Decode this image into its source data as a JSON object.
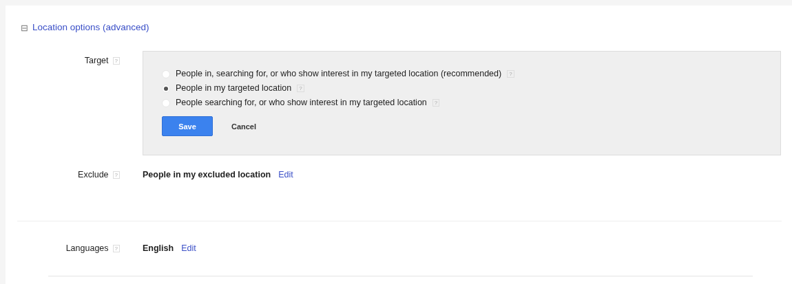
{
  "section": {
    "toggle": "⊟",
    "title": "Location options (advanced)"
  },
  "target": {
    "label": "Target",
    "help": "?",
    "options": [
      {
        "label": "People in, searching for, or who show interest in my targeted location (recommended)",
        "help": "?",
        "selected": false
      },
      {
        "label": "People in my targeted location",
        "help": "?",
        "selected": true
      },
      {
        "label": "People searching for, or who show interest in my targeted location",
        "help": "?",
        "selected": false
      }
    ],
    "buttons": [
      {
        "label": "Save",
        "kind": "primary"
      },
      {
        "label": "Cancel",
        "kind": "plain"
      }
    ]
  },
  "rows": [
    {
      "label": "Exclude",
      "help": "?",
      "value": "People in my excluded location",
      "link": "Edit"
    },
    {
      "label": "Languages",
      "help": "?",
      "value": "English",
      "link": "Edit"
    }
  ]
}
